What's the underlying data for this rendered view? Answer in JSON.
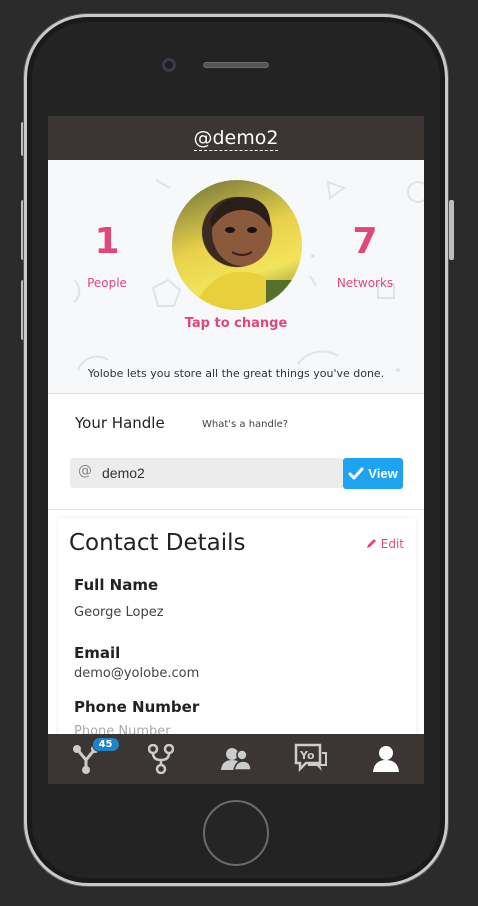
{
  "header": {
    "title": "@demo2"
  },
  "profile": {
    "people_count": "1",
    "people_label": "People",
    "networks_count": "7",
    "networks_label": "Networks",
    "tap_to_change": "Tap to change",
    "tagline": "Yolobe lets you store all the great things you've done."
  },
  "handle": {
    "title": "Your Handle",
    "help_link": "What's a handle?",
    "at_symbol": "@",
    "value": "demo2",
    "view_label": "View"
  },
  "contact": {
    "title": "Contact Details",
    "edit_label": "Edit",
    "fields": [
      {
        "label": "Full Name",
        "value": "George Lopez"
      },
      {
        "label": "Email",
        "value": "demo@yolobe.com"
      },
      {
        "label": "Phone Number",
        "value": "Phone Number"
      }
    ]
  },
  "tabbar": {
    "badge": "45",
    "tabs": [
      "network-icon",
      "fork-icon",
      "people-icon",
      "yo-chat-icon",
      "profile-icon"
    ]
  },
  "colors": {
    "accent": "#e0487c",
    "button": "#1ea3f0",
    "bar": "#3b3633",
    "badge": "#1e84c7"
  }
}
